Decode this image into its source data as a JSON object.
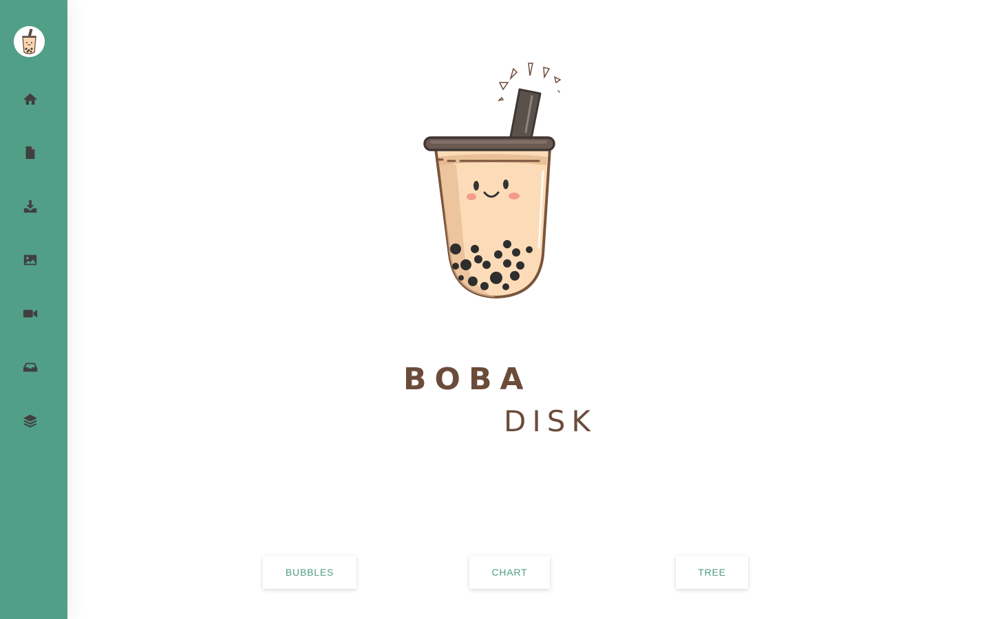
{
  "sidebar": {
    "background": "#529f88",
    "avatar_icon": "boba-cup-icon",
    "items": [
      {
        "icon": "home-icon"
      },
      {
        "icon": "file-icon"
      },
      {
        "icon": "download-icon"
      },
      {
        "icon": "image-icon"
      },
      {
        "icon": "video-icon"
      },
      {
        "icon": "inbox-icon"
      },
      {
        "icon": "layers-icon"
      }
    ]
  },
  "logo": {
    "word1": "BOBA",
    "word2": "DISK",
    "text_color": "#6b4b3a"
  },
  "buttons": {
    "bubbles_label": "BUBBLES",
    "chart_label": "CHART",
    "tree_label": "TREE",
    "accent_color": "#4d9c86"
  }
}
